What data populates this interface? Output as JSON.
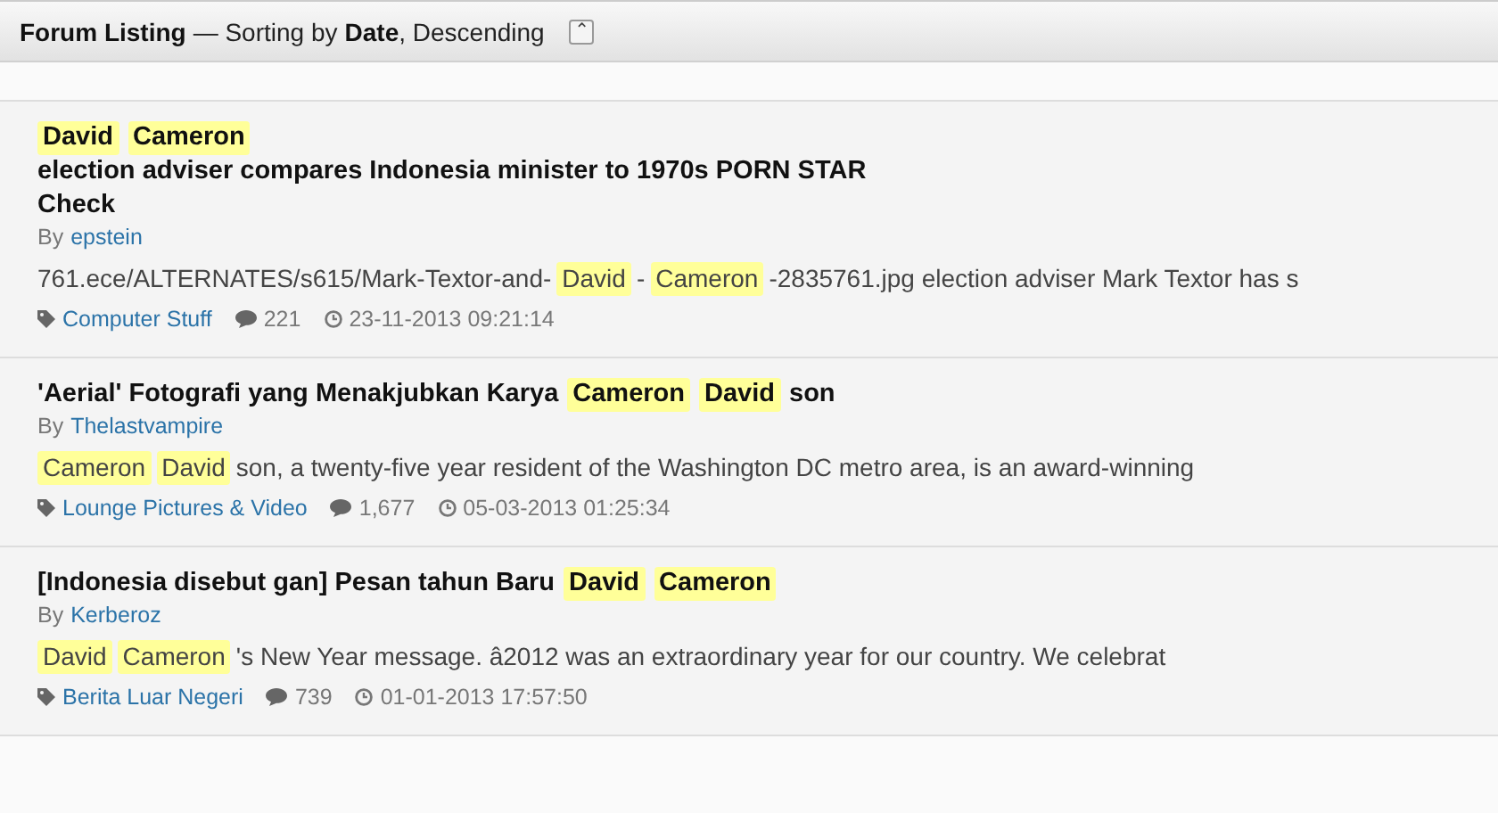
{
  "header": {
    "title": "Forum Listing",
    "sort_prefix": "— Sorting by",
    "sort_field": "Date",
    "sort_order": ", Descending",
    "collapse_icon": "⌃"
  },
  "posts": [
    {
      "title": [
        {
          "text": "David",
          "highlight": true
        },
        {
          "text": "Cameron",
          "highlight": true
        },
        {
          "text": "election adviser compares Indonesia minister to 1970s PORN STAR Check",
          "highlight": false
        }
      ],
      "by": "By",
      "author": "epstein",
      "snippet": [
        {
          "text": "761.ece/ALTERNATES/s615/Mark-Textor-and-",
          "highlight": false
        },
        {
          "text": "David",
          "highlight": true
        },
        {
          "text": "-",
          "highlight": false
        },
        {
          "text": "Cameron",
          "highlight": true
        },
        {
          "text": "-2835761.jpg election adviser Mark Textor has s",
          "highlight": false
        }
      ],
      "forum": "Computer Stuff",
      "replies": "221",
      "date": "23-11-2013 09:21:14"
    },
    {
      "title": [
        {
          "text": "'Aerial' Fotografi yang Menakjubkan Karya",
          "highlight": false
        },
        {
          "text": "Cameron",
          "highlight": true
        },
        {
          "text": "David",
          "highlight": true
        },
        {
          "text": "son",
          "highlight": false
        }
      ],
      "by": "By",
      "author": "Thelastvampire",
      "snippet": [
        {
          "text": "Cameron",
          "highlight": true
        },
        {
          "text": "David",
          "highlight": true
        },
        {
          "text": "son, a twenty-five year resident of the Washington DC metro area, is an award-winning",
          "highlight": false
        }
      ],
      "forum": "Lounge Pictures & Video",
      "replies": "1,677",
      "date": "05-03-2013 01:25:34"
    },
    {
      "title": [
        {
          "text": "[Indonesia disebut gan] Pesan tahun Baru",
          "highlight": false
        },
        {
          "text": "David",
          "highlight": true
        },
        {
          "text": "Cameron",
          "highlight": true
        }
      ],
      "by": "By",
      "author": "Kerberoz",
      "snippet": [
        {
          "text": "David",
          "highlight": true
        },
        {
          "text": "Cameron",
          "highlight": true
        },
        {
          "text": "'s New Year message. â2012 was an extraordinary year for our country. We celebrat",
          "highlight": false
        }
      ],
      "forum": "Berita Luar Negeri",
      "replies": "739",
      "date": "01-01-2013 17:57:50"
    }
  ]
}
